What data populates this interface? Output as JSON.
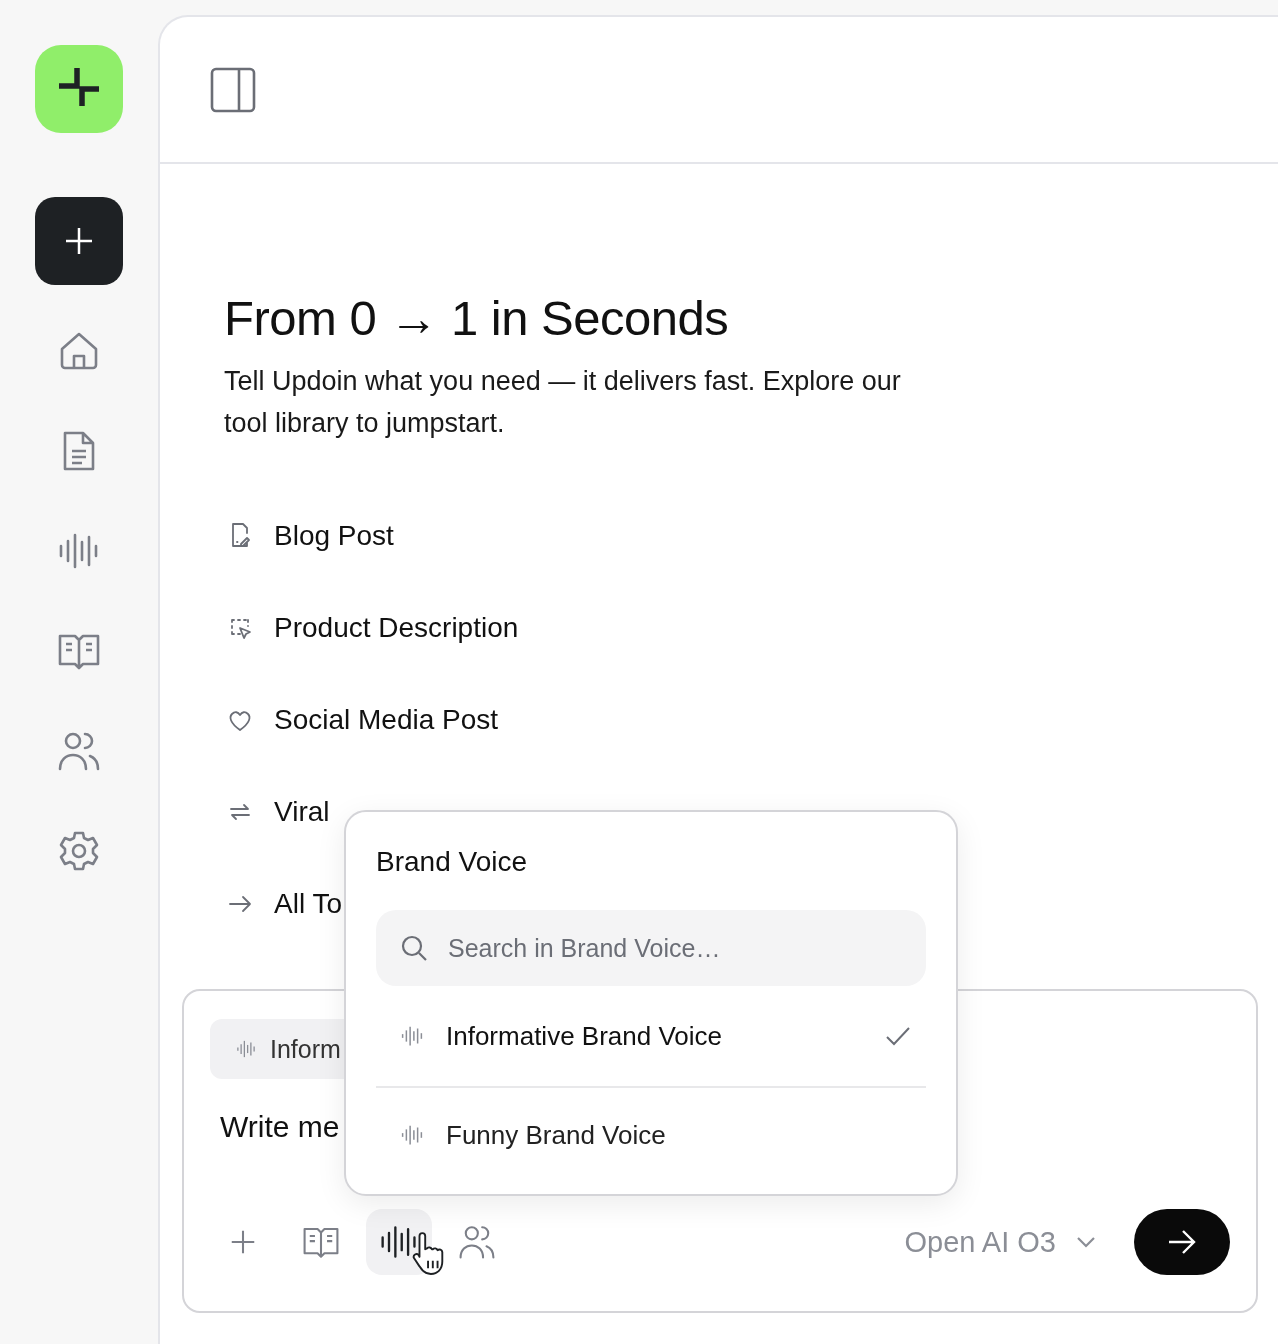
{
  "hero": {
    "title": "From 0 → 1 in Seconds",
    "description": "Tell Updoin what you need — it delivers fast. Explore our tool library to jumpstart."
  },
  "tools": [
    {
      "kind": "blog",
      "label": "Blog Post"
    },
    {
      "kind": "product",
      "label": "Product Description"
    },
    {
      "kind": "social",
      "label": "Social Media Post"
    },
    {
      "kind": "viral",
      "label": "Viral"
    },
    {
      "kind": "all",
      "label": "All To"
    }
  ],
  "composer": {
    "chip": "Inform",
    "text": "Write me",
    "model": "Open AI O3",
    "tools": [
      {
        "kind": "add",
        "selected": false
      },
      {
        "kind": "library",
        "selected": false
      },
      {
        "kind": "voice",
        "selected": true
      },
      {
        "kind": "people",
        "selected": false
      }
    ]
  },
  "dropdown": {
    "title": "Brand Voice",
    "placeholder": "Search in Brand Voice…",
    "options": [
      {
        "label": "Informative Brand Voice",
        "selected": true
      },
      {
        "label": "Funny Brand Voice",
        "selected": false
      }
    ]
  }
}
